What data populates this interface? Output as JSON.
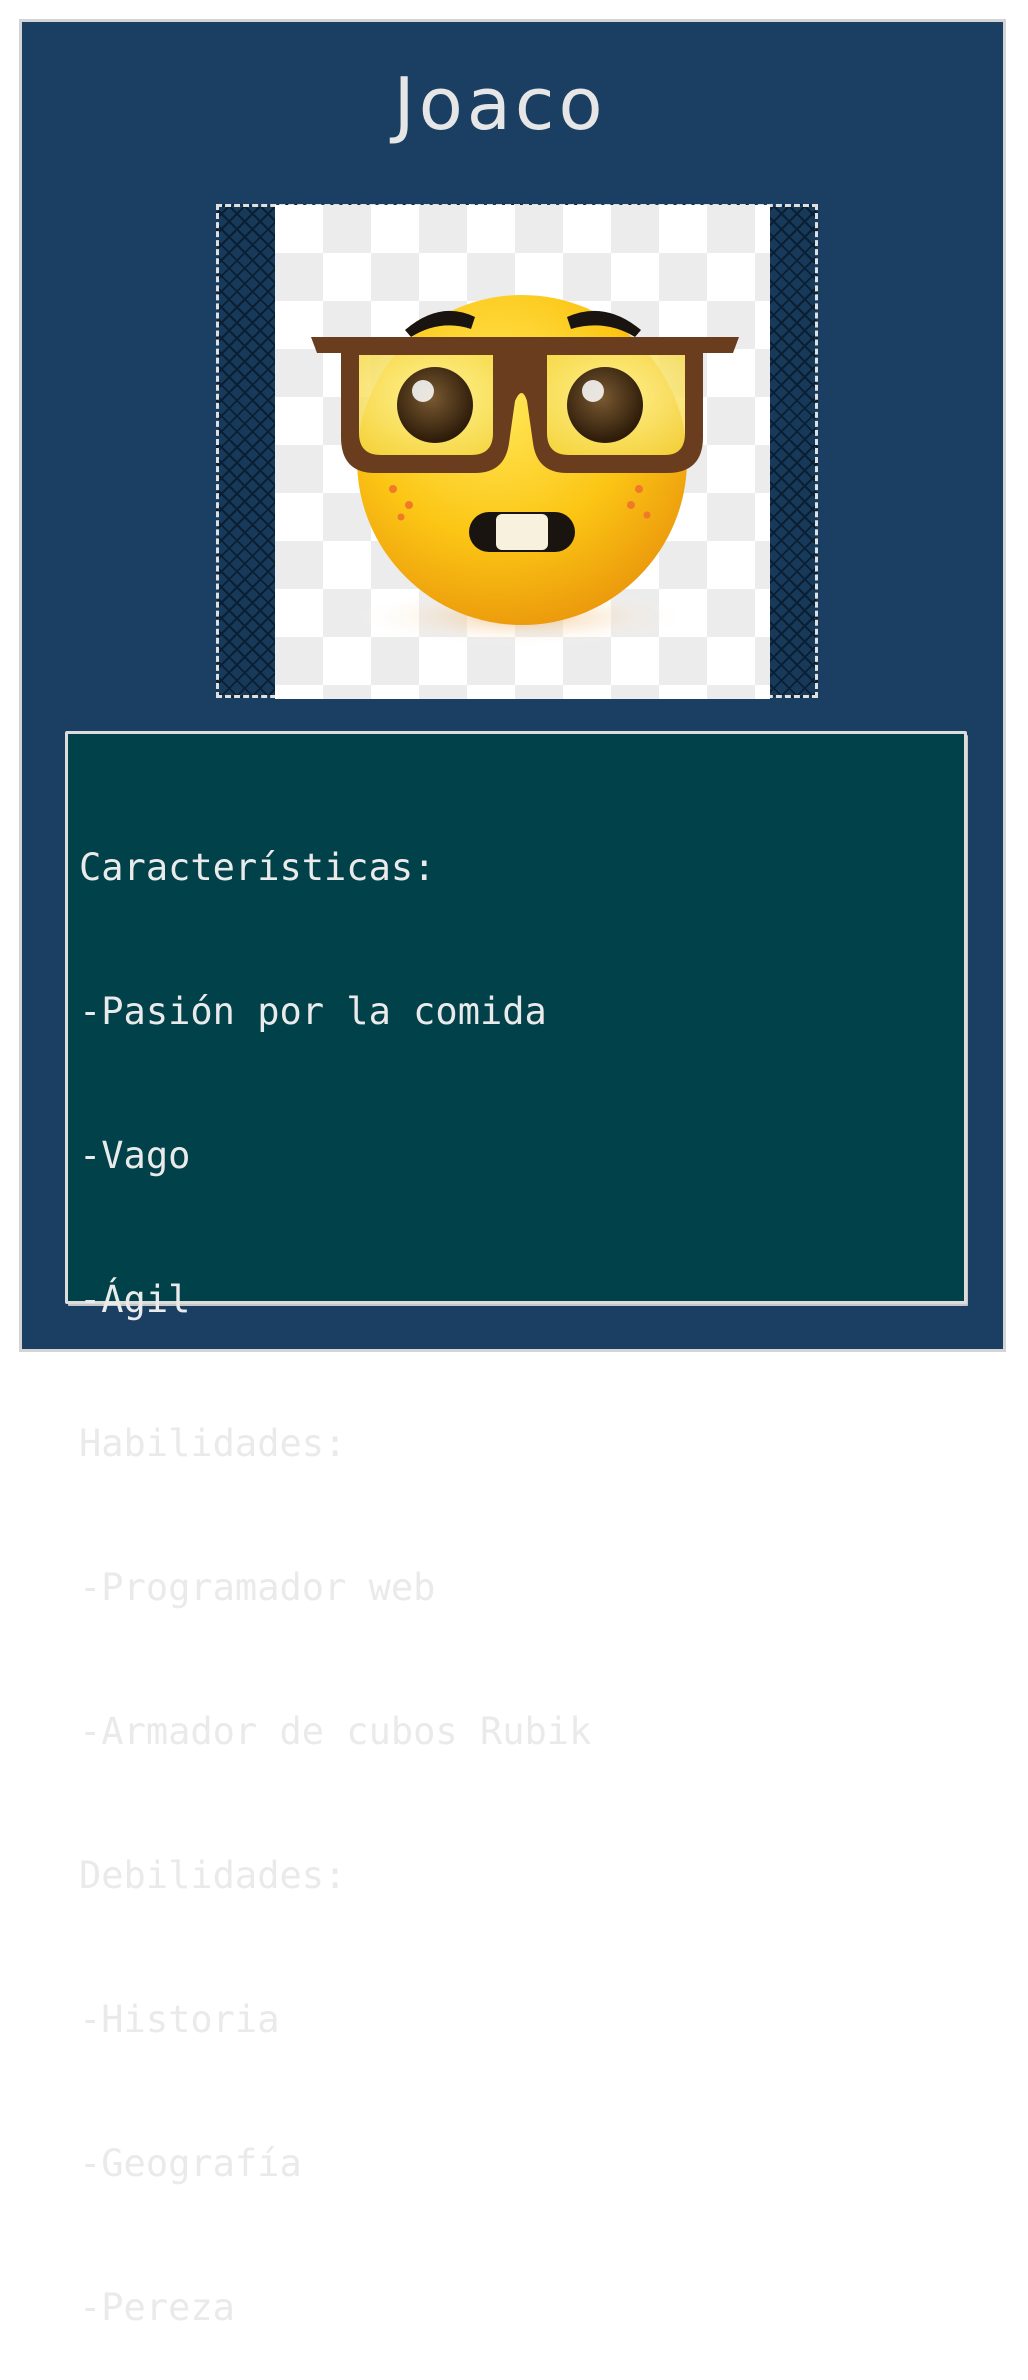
{
  "card": {
    "title": "Joaco",
    "colors": {
      "background": "#1a3f63",
      "text_panel": "#00414a",
      "text": "#eaeaea"
    },
    "image": {
      "icon": "nerd-face-emoji"
    },
    "lines": [
      "Características:",
      "-Pasión por la comida",
      "-Vago",
      "-Ágil",
      "Habilidades:",
      "-Programador web",
      "-Armador de cubos Rubik",
      "Debilidades:",
      "-Historia",
      "-Geografía",
      "-Pereza"
    ]
  }
}
